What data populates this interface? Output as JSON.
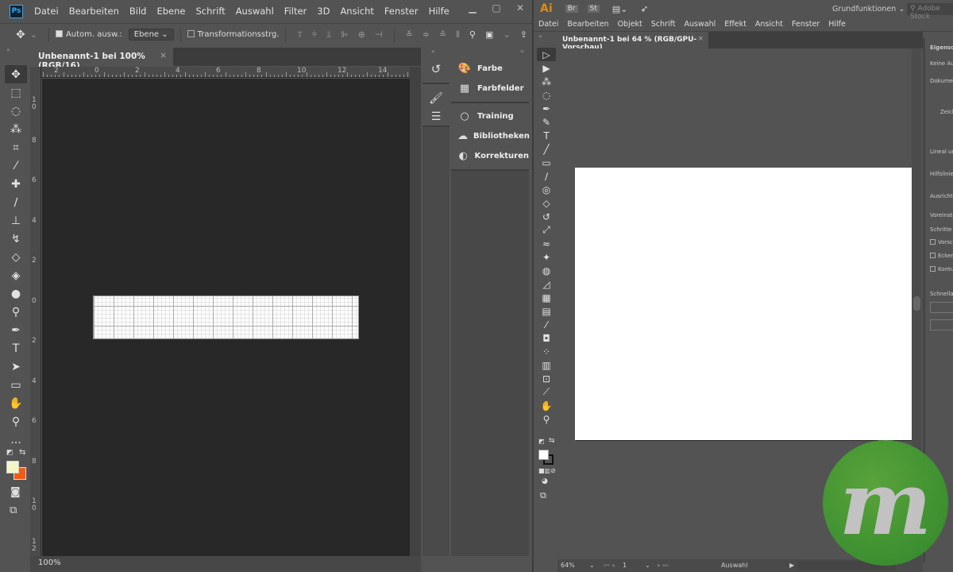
{
  "photoshop": {
    "logo": "Ps",
    "menu": [
      "Datei",
      "Bearbeiten",
      "Bild",
      "Ebene",
      "Schrift",
      "Auswahl",
      "Filter",
      "3D",
      "Ansicht",
      "Fenster",
      "Hilfe"
    ],
    "window_controls": [
      "minimize-icon",
      "maximize-icon",
      "close-icon"
    ],
    "options": {
      "auto_select_label": "Autom. ausw.:",
      "auto_select_checked": true,
      "auto_select_target": "Ebene",
      "transform_label": "Transformationsstrg.",
      "transform_checked": false
    },
    "tab": {
      "title": "Unbenannt-1 bei 100% (RGB/16)",
      "close": "×"
    },
    "ruler_top": [
      "2",
      "0",
      "2",
      "4",
      "6",
      "8",
      "10",
      "12",
      "14"
    ],
    "ruler_left": [
      "10",
      "8",
      "6",
      "4",
      "2",
      "0",
      "2",
      "4",
      "6",
      "8",
      "10",
      "12"
    ],
    "tools": [
      "move-icon",
      "marquee-icon",
      "lasso-icon",
      "magic-wand-icon",
      "crop-icon",
      "eyedropper-icon",
      "healing-brush-icon",
      "brush-icon",
      "clone-stamp-icon",
      "history-brush-icon",
      "eraser-icon",
      "paint-bucket-icon",
      "blur-icon",
      "dodge-icon",
      "pen-icon",
      "type-icon",
      "path-selection-icon",
      "rectangle-icon",
      "hand-icon",
      "zoom-icon",
      "more-tools-icon"
    ],
    "colors": {
      "foreground": "#f2f7c8",
      "background": "#f05a1a"
    },
    "panels": {
      "group1": [
        {
          "icon": "palette-icon",
          "label": "Farbe"
        },
        {
          "icon": "swatches-icon",
          "label": "Farbfelder"
        }
      ],
      "group2": [
        {
          "icon": "lightbulb-icon",
          "label": "Training"
        },
        {
          "icon": "libraries-icon",
          "label": "Bibliotheken"
        },
        {
          "icon": "adjustments-icon",
          "label": "Korrekturen"
        }
      ]
    },
    "status_zoom": "100%"
  },
  "illustrator": {
    "logo": "Ai",
    "topbar": {
      "bridge": "Br",
      "stock": "St",
      "workspace": "Grundfunktionen",
      "search_placeholder": "Adobe Stock"
    },
    "menu": [
      "Datei",
      "Bearbeiten",
      "Objekt",
      "Schrift",
      "Auswahl",
      "Effekt",
      "Ansicht",
      "Fenster",
      "Hilfe"
    ],
    "tab": {
      "title": "Unbenannt-1 bei 64 % (RGB/GPU-Vorschau)",
      "close": "×"
    },
    "tools": [
      "selection-icon",
      "direct-selection-icon",
      "magic-wand-icon",
      "lasso-icon",
      "pen-icon",
      "curvature-icon",
      "type-icon",
      "line-icon",
      "rectangle-icon",
      "paintbrush-icon",
      "shaper-icon",
      "eraser-icon",
      "rotate-icon",
      "scale-icon",
      "warp-icon",
      "puppet-warp-icon",
      "shape-builder-icon",
      "perspective-icon",
      "mesh-icon",
      "gradient-icon",
      "eyedropper-icon",
      "blend-icon",
      "symbol-sprayer-icon",
      "graph-icon",
      "artboard-icon",
      "slice-icon",
      "hand-icon",
      "zoom-icon"
    ],
    "properties": {
      "title": "Eigenscha",
      "no_selection": "Keine Aus",
      "document": "Dokumen",
      "artboard": "Zeiche",
      "rulers": "Lineal und",
      "guides": "Hilfslinien",
      "snap": "Ausrichten",
      "preferences": "Voreinstel",
      "steps": "Schritte p",
      "checkboxes": [
        "Vorsc",
        "Ecken",
        "Kontu"
      ],
      "quick_actions": "Schnellakt"
    },
    "status": {
      "zoom": "64%",
      "artboard": "1",
      "tool": "Auswahl"
    }
  },
  "watermark": {
    "text": "m",
    "color": "#3f9a30"
  }
}
